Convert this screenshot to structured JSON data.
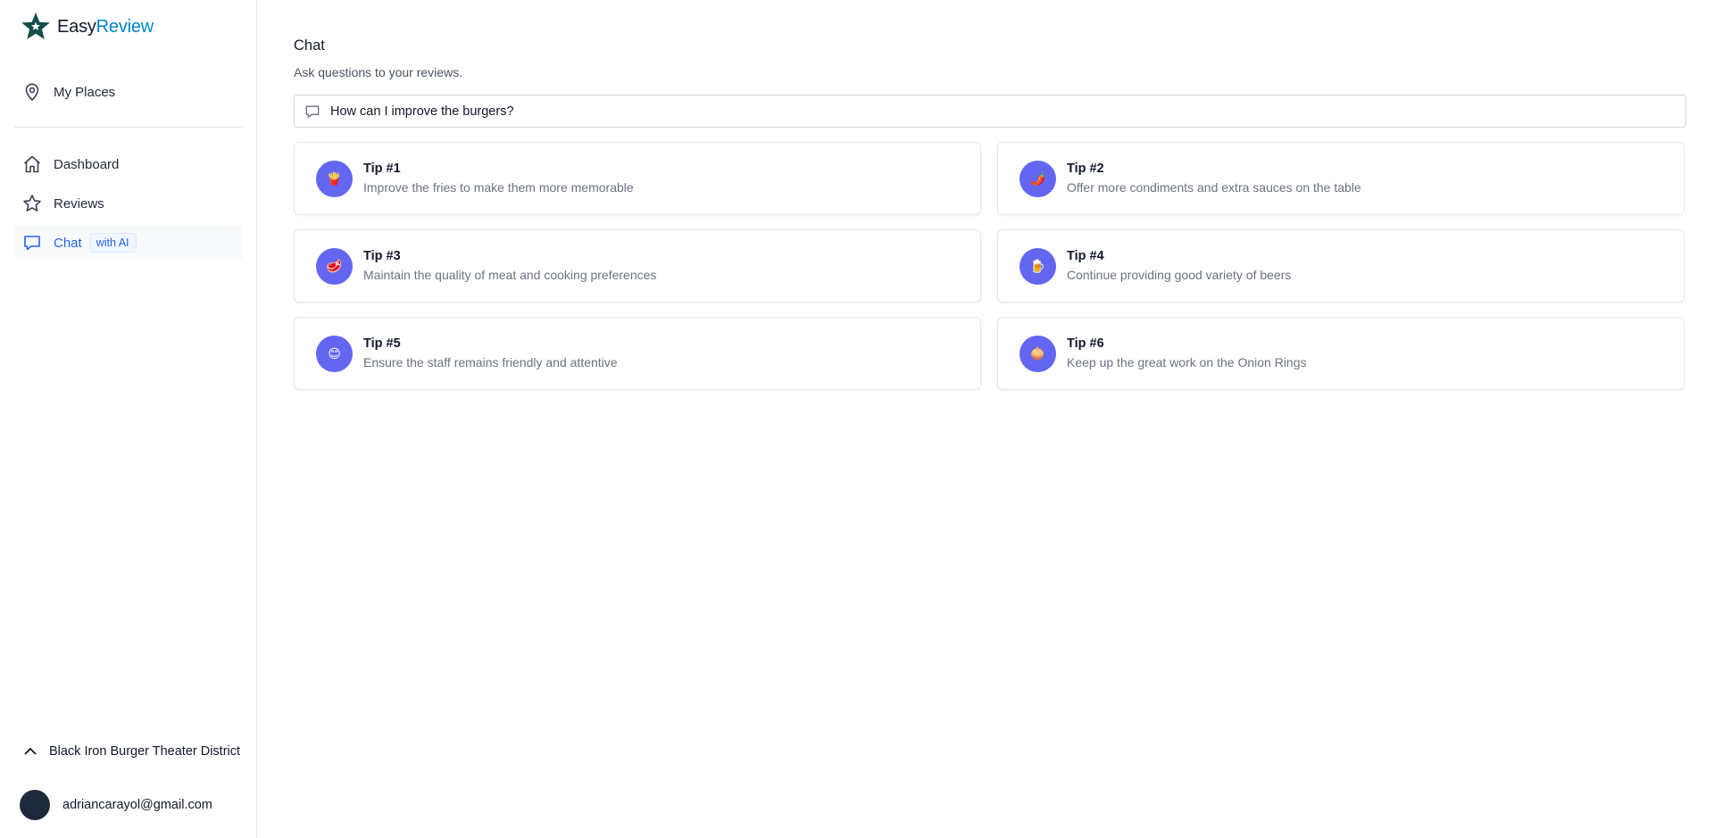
{
  "brand": {
    "part1": "Easy",
    "part2": "Review"
  },
  "sidebar": {
    "top_items": [
      {
        "label": "My Places",
        "icon": "map-pin-icon"
      }
    ],
    "items": [
      {
        "label": "Dashboard",
        "icon": "home-icon"
      },
      {
        "label": "Reviews",
        "icon": "star-icon"
      },
      {
        "label": "Chat",
        "icon": "chat-bubble-icon",
        "badge": "with AI",
        "active": true
      }
    ],
    "place_name": "Black Iron Burger Theater District",
    "user_email": "adriancarayol@gmail.com"
  },
  "main": {
    "title": "Chat",
    "subtitle": "Ask questions to your reviews.",
    "input_value": "How can I improve the burgers?",
    "tips": [
      {
        "title": "Tip #1",
        "text": "Improve the fries to make them more memorable",
        "emoji": "🍟"
      },
      {
        "title": "Tip #2",
        "text": "Offer more condiments and extra sauces on the table",
        "emoji": "🌶️"
      },
      {
        "title": "Tip #3",
        "text": "Maintain the quality of meat and cooking preferences",
        "emoji": "🥩"
      },
      {
        "title": "Tip #4",
        "text": "Continue providing good variety of beers",
        "emoji": "🍺"
      },
      {
        "title": "Tip #5",
        "text": "Ensure the staff remains friendly and attentive",
        "emoji": "😊"
      },
      {
        "title": "Tip #6",
        "text": "Keep up the great work on the Onion Rings",
        "emoji": "🧅"
      }
    ]
  },
  "colors": {
    "accent": "#2563eb",
    "brand": "#0284c7",
    "tip_icon_bg": "#6366f1"
  }
}
